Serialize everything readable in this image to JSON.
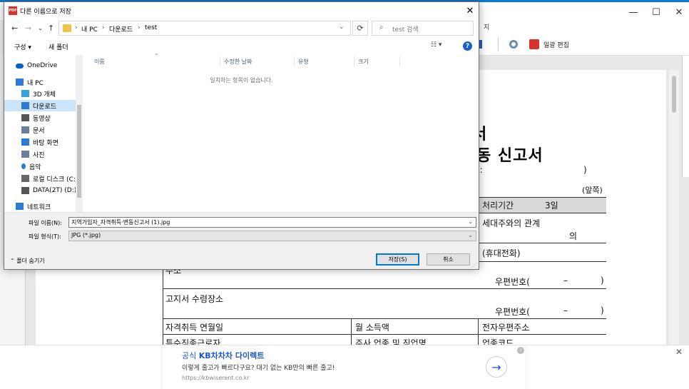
{
  "dialog": {
    "title": "다른 이름으로 저장",
    "app_icon": "PDF",
    "breadcrumbs": [
      "내 PC",
      "다운로드",
      "test"
    ],
    "search_placeholder": "test 검색",
    "toolbar": {
      "organize": "구성 ▾",
      "new_folder": "새 폴더"
    },
    "nav_items": [
      {
        "label": "OneDrive",
        "icon": "cloud-icon",
        "color": "#0a62c9"
      },
      {
        "label": "내 PC",
        "icon": "computer-icon",
        "color": "#2f7ad6"
      },
      {
        "label": "3D 개체",
        "icon": "cube-icon",
        "color": "#3aa0d8"
      },
      {
        "label": "다운로드",
        "icon": "download-icon",
        "color": "#2b7bd4"
      },
      {
        "label": "동영상",
        "icon": "video-icon",
        "color": "#555555"
      },
      {
        "label": "문서",
        "icon": "document-icon",
        "color": "#6b7fa0"
      },
      {
        "label": "바탕 화면",
        "icon": "desktop-icon",
        "color": "#2b7bd4"
      },
      {
        "label": "사진",
        "icon": "picture-icon",
        "color": "#6b7fa0"
      },
      {
        "label": "음악",
        "icon": "music-icon",
        "color": "#2b7bd4"
      },
      {
        "label": "로컬 디스크 (C:)",
        "icon": "disk-icon",
        "color": "#666666"
      },
      {
        "label": "DATA(2T) (D:)",
        "icon": "drive-icon",
        "color": "#555555"
      },
      {
        "label": "네트워크",
        "icon": "network-icon",
        "color": "#2b7bd4"
      }
    ],
    "columns": [
      "이름",
      "수정한 날짜",
      "유형",
      "크기"
    ],
    "empty_message": "일치하는 항목이 없습니다.",
    "filename_label": "파일 이름(N):",
    "filename_value": "지역가입자_자격취득·변동신고서 (1).jpg",
    "filetype_label": "파일 형식(T):",
    "filetype_value": "JPG (*.jpg)",
    "hide_folders": "폴더 숨기기",
    "save_button": "저장(S)",
    "cancel_button": "취소"
  },
  "app": {
    "menu_partial": "지",
    "toolbar_label": "일괄 편집"
  },
  "document": {
    "title_line1": "서",
    "title_line2": "동 신고서",
    "paren_close": "):",
    "front": "(앞쪽)",
    "processing_label": "처리기간",
    "processing_value": "3일",
    "household_relation": "세대주와의 관계",
    "of": "의",
    "mobile": "(휴대전화)",
    "address_partial": "주소",
    "postal": "우편번호(",
    "dash": "–",
    "close_paren": ")",
    "notice_place": "고지서 수령장소",
    "postal2": "우편번호(",
    "acq_date": "자격취득 연월일",
    "monthly_income": "월 소득액",
    "email": "전자우편주소",
    "row_partial1": "특수직종근로자",
    "row_partial2": "주사 업종 및 직업명",
    "row_partial3": "업종코드"
  },
  "ad": {
    "title_prefix": "공식",
    "title_brand": "KB차차차 다이렉트",
    "description": "이렇게 줄고가 빠르다구요? 대기 없는 KB만의 빠른 줄고!",
    "url": "https://kbwiserent.co.kr"
  }
}
